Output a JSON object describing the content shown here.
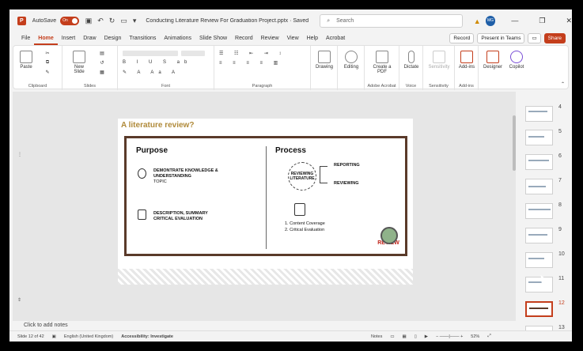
{
  "titlebar": {
    "autosave_label": "AutoSave",
    "toggle_label": "On",
    "doc_title": "Conducting Literature Review For Graduation Project.pptx · Saved",
    "search_placeholder": "Search",
    "avatar_initials": "MG"
  },
  "tabs": [
    "File",
    "Home",
    "Insert",
    "Draw",
    "Design",
    "Transitions",
    "Animations",
    "Slide Show",
    "Record",
    "Review",
    "View",
    "Help",
    "Acrobat"
  ],
  "tab_actions": {
    "record": "Record",
    "present": "Present in Teams",
    "share": "Share"
  },
  "ribbon": {
    "groups": [
      "Clipboard",
      "Slides",
      "Font",
      "Paragraph",
      "Adobe Acrobat",
      "Voice",
      "Sensitivity",
      "Add-ins"
    ],
    "buttons": {
      "paste": "Paste",
      "new_slide": "New Slide",
      "drawing": "Drawing",
      "editing": "Editing",
      "create_pdf": "Create a PDF",
      "dictate": "Dictate",
      "sensitivity": "Sensitivity",
      "addins": "Add-ins",
      "designer": "Designer",
      "copilot": "Copilot"
    }
  },
  "slide": {
    "title": "A literature review?",
    "purpose_heading": "Purpose",
    "process_heading": "Process",
    "purpose_item1": "DEMONTRATE KNOWLEDGE & UNDERSTANDING",
    "purpose_item1_sub": "TOPIC",
    "purpose_item2": "DESCRIPTION, SUMMARY CRITICAL EVALUATION",
    "circle_label": "REVIEWING LITERATURE",
    "branch1": "REPORTING",
    "branch2": "REVIEWING",
    "list1": "1.  Content Coverage",
    "list2": "2.  Critical Evaluation",
    "badge": "REVIEW"
  },
  "notes_placeholder": "Click to add notes",
  "thumbnails": [
    "4",
    "5",
    "6",
    "7",
    "8",
    "9",
    "10",
    "11",
    "12",
    "13"
  ],
  "selected_slide": "12",
  "status": {
    "slide_info": "Slide 12 of 42",
    "language": "English (United Kingdom)",
    "accessibility": "Accessibility: Investigate",
    "notes": "Notes",
    "zoom": "52%"
  }
}
